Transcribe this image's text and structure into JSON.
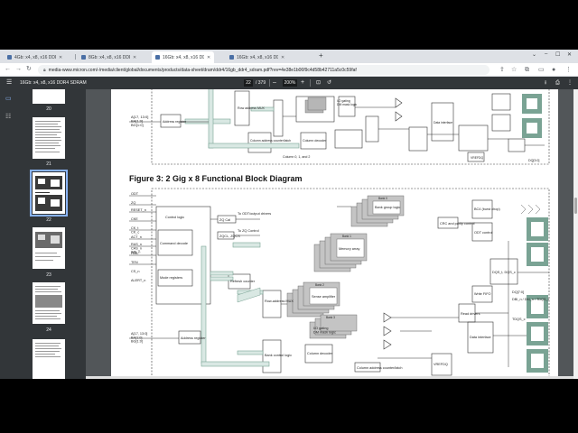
{
  "browser": {
    "tabs": [
      {
        "label": "4Gb: x4, x8, x16 DDR4 SDRAM",
        "active": false
      },
      {
        "label": "8Gb: x4, x8, x16 DDR4 SDRAM",
        "active": false
      },
      {
        "label": "16Gb: x4, x8, x16 DDR4 SDRAM",
        "active": true
      },
      {
        "label": "16Gb: x4, x8, x16 DDR4 SDRAM",
        "active": false
      }
    ],
    "url": "media-www.micron.com/-/media/client/global/documents/products/data-sheet/dram/ddr4/16gb_ddr4_sdram.pdf?rev=4e38e1b06f9c4d58b42711a5c0c59faf"
  },
  "pdf": {
    "title": "16Gb: x4, x8, x16 DDR4 SDRAM",
    "current_page": "22",
    "total_pages": "/ 379",
    "zoom": "200%"
  },
  "thumbnails": [
    {
      "num": "20",
      "selected": false
    },
    {
      "num": "21",
      "selected": false
    },
    {
      "num": "22",
      "selected": true
    },
    {
      "num": "23",
      "selected": false
    },
    {
      "num": "24",
      "selected": false
    }
  ],
  "document": {
    "figure_title": "Figure 3: 2 Gig x 8 Functional Block Diagram",
    "fig2_labels": {
      "addr_in": "A[17, 13:0]\nBA[1:0]\nBG[1:0]",
      "address_register": "Address register",
      "row_addr": "Row address MUX",
      "io_gating": "I/O gating\nDM mask logic",
      "column_decoder": "Column decoder",
      "column_address_latch": "Column address counter/latch",
      "column_label": "Column 0, 1, and 2",
      "data_interface": "Data interface",
      "vref": "VREFDQ",
      "dq_label": "DQ[3:0]"
    },
    "fig3_labels": {
      "odt": "ODT",
      "zq": "ZQ",
      "reset": "RESET_n",
      "cke": "CKE",
      "ck": "CK_t\nCK_c",
      "act": "ACT_n",
      "ras": "RAS_n\nCAS_n\nWE_n",
      "par": "PAR",
      "ten": "TEN",
      "cs": "CS_n",
      "alert": "ALERT_n",
      "control_logic": "Control logic",
      "zq_cal": "ZQ Cal",
      "zqcl": "ZQCL, ZQCS",
      "to_odt": "To ODT/output drivers",
      "to_zq": "To ZQ Control",
      "command_decode": "Command decode",
      "mode_registers": "Mode registers",
      "refresh_counter": "Refresh counter",
      "row_address_mux": "Row-address MUX",
      "bank_control": "Bank control logic",
      "bank_group": "Bank group logic",
      "memory_array": "Memory array",
      "sense_amplifier": "Sense amplifier",
      "io_gating": "I/O gating\nDM mask logic",
      "column_decoder": "Column decoder",
      "column_address_counter": "Column address counter/latch",
      "address_register": "Address register",
      "addr_in": "A[17, 13:0]\nBA[1:0]\nBG[1:0]",
      "read_drivers": "Read drivers",
      "write_fifo": "Write FIFO",
      "data_interface": "Data interface",
      "crc": "CRC and parity control",
      "bc_otf": "BC4 (burst chop)",
      "odt_control": "ODT control",
      "vref": "VREFDQ",
      "dq": "DQ[7:0]",
      "dqs": "DQS_t, DQS_c",
      "dbi": "DBI_n / DM_n / TDQS_t",
      "tdqs": "TDQS_c",
      "banks": [
        "Bank 0",
        "Bank 1",
        "Bank 2",
        "Bank 3"
      ]
    }
  }
}
